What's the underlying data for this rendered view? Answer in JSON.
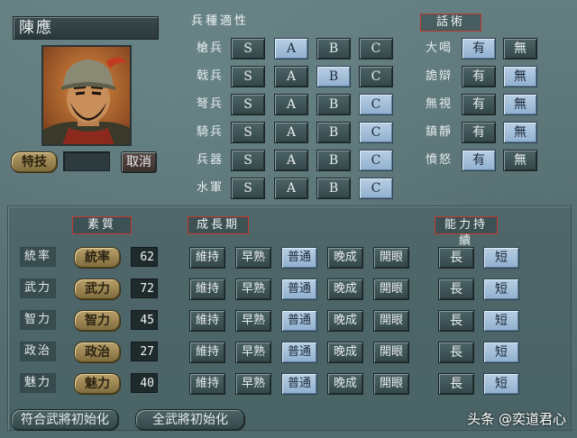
{
  "character": {
    "name": "陳應"
  },
  "skill": {
    "label": "特技",
    "cancel_label": "取消"
  },
  "troop_section": {
    "title": "兵種適性",
    "grades": [
      "S",
      "A",
      "B",
      "C"
    ],
    "rows": [
      {
        "label": "槍兵",
        "selected": "A"
      },
      {
        "label": "戟兵",
        "selected": "B"
      },
      {
        "label": "弩兵",
        "selected": "C"
      },
      {
        "label": "騎兵",
        "selected": "C"
      },
      {
        "label": "兵器",
        "selected": "C"
      },
      {
        "label": "水軍",
        "selected": "C"
      }
    ]
  },
  "speech_section": {
    "title": "話術",
    "options": [
      "有",
      "無"
    ],
    "rows": [
      {
        "label": "大喝",
        "selected": "有"
      },
      {
        "label": "詭辯",
        "selected": "無"
      },
      {
        "label": "無視",
        "selected": "無"
      },
      {
        "label": "鎮靜",
        "selected": "無"
      },
      {
        "label": "憤怒",
        "selected": "有"
      }
    ]
  },
  "stats_section": {
    "aptitude_title": "素質",
    "growth_title": "成長期",
    "duration_title": "能力持續",
    "growth_options": [
      "維持",
      "早熟",
      "普通",
      "晚成",
      "開眼"
    ],
    "duration_options": [
      "長",
      "短"
    ],
    "rows": [
      {
        "label": "統率",
        "button": "統率",
        "value": "62",
        "growth": "普通",
        "duration": "短"
      },
      {
        "label": "武力",
        "button": "武力",
        "value": "72",
        "growth": "普通",
        "duration": "短"
      },
      {
        "label": "智力",
        "button": "智力",
        "value": "45",
        "growth": "普通",
        "duration": "短"
      },
      {
        "label": "政治",
        "button": "政治",
        "value": "27",
        "growth": "普通",
        "duration": "短"
      },
      {
        "label": "魅力",
        "button": "魅力",
        "value": "40",
        "growth": "普通",
        "duration": "短"
      }
    ]
  },
  "footer": {
    "init_matching": "符合武將初始化",
    "init_all": "全武將初始化"
  },
  "watermark": "头条 @奕道君心",
  "colors": {
    "background": "#5b7377",
    "selected_button": "#a9c4de",
    "gold_button": "#a08a55",
    "header_border": "#c0392b"
  }
}
